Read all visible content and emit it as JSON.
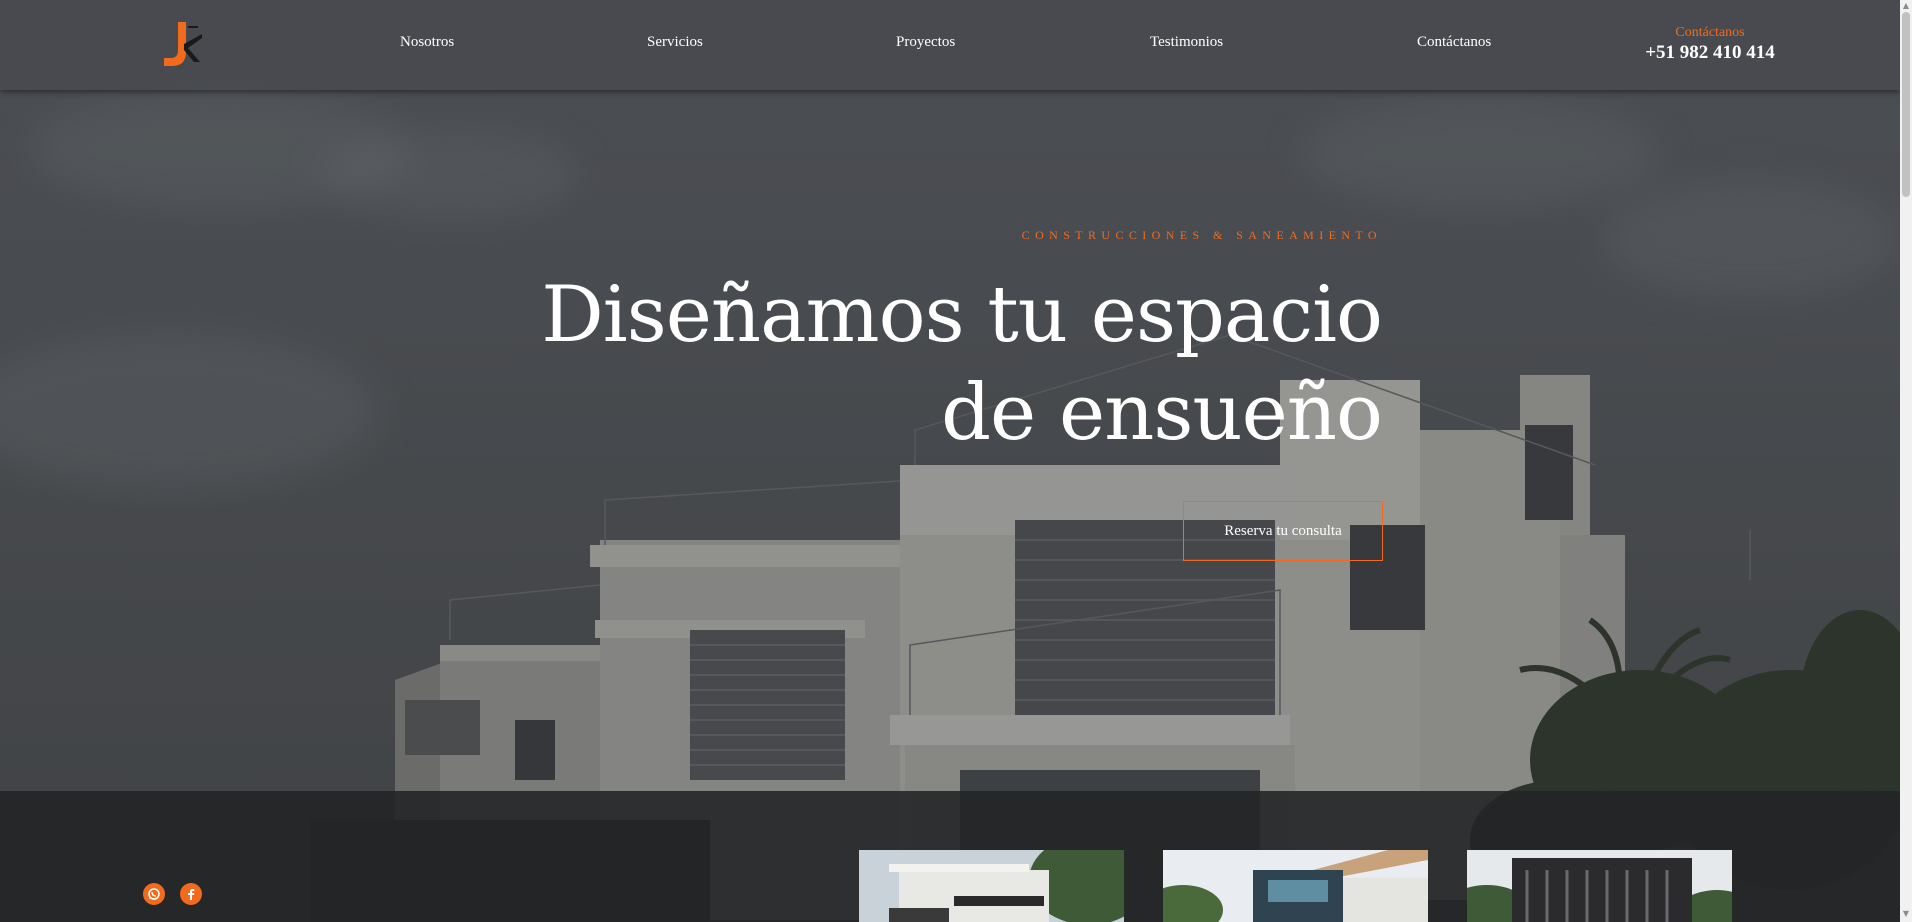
{
  "header": {
    "logo_icon": "jr-logo-icon",
    "nav": [
      {
        "label": "Nosotros"
      },
      {
        "label": "Servicios"
      },
      {
        "label": "Proyectos"
      },
      {
        "label": "Testimonios"
      },
      {
        "label": "Contáctanos"
      }
    ],
    "contact_label": "Contáctanos",
    "contact_phone": "+51 982 410 414"
  },
  "hero": {
    "tagline": "CONSTRUCCIONES & SANEAMIENTO",
    "headline_line1": "Diseñamos tu espacio",
    "headline_line2": "de ensueño",
    "cta_label": "Reserva tu consulta"
  },
  "footer_band": {
    "social": [
      {
        "icon": "whatsapp-icon"
      },
      {
        "icon": "facebook-icon"
      }
    ],
    "project_thumbnails": 3
  },
  "colors": {
    "accent": "#f26b1d",
    "header_bg": "#484a4f",
    "band_bg": "#222325",
    "text": "#ffffff"
  }
}
